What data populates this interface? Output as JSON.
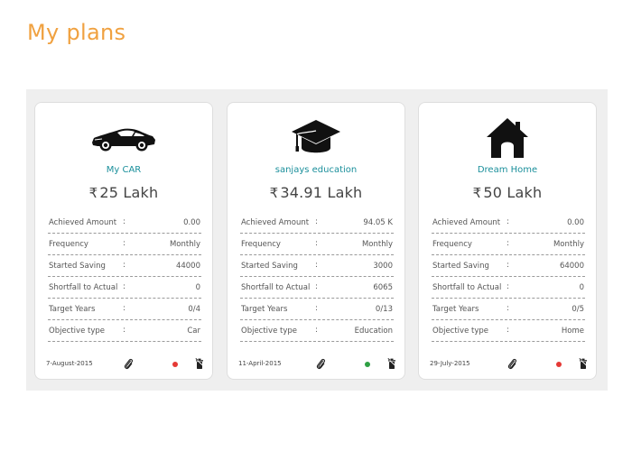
{
  "page": {
    "title": "My plans"
  },
  "currency_symbol": "₹",
  "plans": [
    {
      "name": "My CAR",
      "icon": "car-icon",
      "amount": "25 Lakh",
      "rows": [
        {
          "label": "Achieved Amount",
          "sep": ":",
          "value": "0.00"
        },
        {
          "label": "Frequency",
          "sep": ":",
          "value": "Monthly"
        },
        {
          "label": "Started Saving",
          "sep": ":",
          "value": "44000"
        },
        {
          "label": "Shortfall to Actual",
          "sep": ":",
          "value": "0"
        },
        {
          "label": "Target Years",
          "sep": ":",
          "value": "0/4"
        },
        {
          "label": "Objective type",
          "sep": ":",
          "value": "Car"
        }
      ],
      "date": "7-August-2015",
      "status_color": "#e53935"
    },
    {
      "name": "sanjays education",
      "icon": "graduation-cap-icon",
      "amount": "34.91 Lakh",
      "rows": [
        {
          "label": "Achieved Amount",
          "sep": ":",
          "value": "94.05 K"
        },
        {
          "label": "Frequency",
          "sep": ":",
          "value": "Monthly"
        },
        {
          "label": "Started Saving",
          "sep": ":",
          "value": "3000"
        },
        {
          "label": "Shortfall to Actual",
          "sep": ":",
          "value": "6065"
        },
        {
          "label": "Target Years",
          "sep": ":",
          "value": "0/13"
        },
        {
          "label": "Objective type",
          "sep": ":",
          "value": "Education"
        }
      ],
      "date": "11-April-2015",
      "status_color": "#2ea043"
    },
    {
      "name": "Dream Home",
      "icon": "house-icon",
      "amount": "50 Lakh",
      "rows": [
        {
          "label": "Achieved Amount",
          "sep": ":",
          "value": "0.00"
        },
        {
          "label": "Frequency",
          "sep": ":",
          "value": "Monthly"
        },
        {
          "label": "Started Saving",
          "sep": ":",
          "value": "64000"
        },
        {
          "label": "Shortfall to Actual",
          "sep": ":",
          "value": "0"
        },
        {
          "label": "Target Years",
          "sep": ":",
          "value": "0/5"
        },
        {
          "label": "Objective type",
          "sep": ":",
          "value": "Home"
        }
      ],
      "date": "29-July-2015",
      "status_color": "#e53935"
    }
  ],
  "colors": {
    "title": "#F0A140",
    "plan_name": "#1a8f9b",
    "panel_bg": "#efefef"
  }
}
